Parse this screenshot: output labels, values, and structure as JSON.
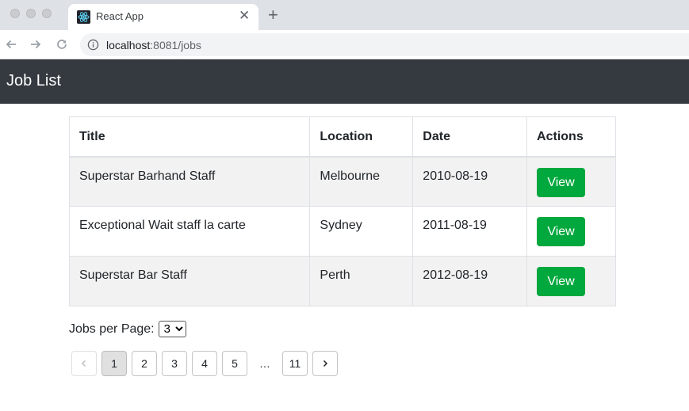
{
  "browser": {
    "tab_title": "React App",
    "tab_close": "✕",
    "new_tab": "+",
    "url_host": "localhost",
    "url_rest": ":8081/jobs"
  },
  "header": {
    "title": "Job List"
  },
  "table": {
    "columns": [
      "Title",
      "Location",
      "Date",
      "Actions"
    ],
    "rows": [
      {
        "title": "Superstar Barhand Staff",
        "location": "Melbourne",
        "date": "2010-08-19",
        "action": "View"
      },
      {
        "title": "Exceptional Wait staff la carte",
        "location": "Sydney",
        "date": "2011-08-19",
        "action": "View"
      },
      {
        "title": "Superstar Bar Staff",
        "location": "Perth",
        "date": "2012-08-19",
        "action": "View"
      }
    ]
  },
  "per_page": {
    "label": "Jobs per Page:",
    "selected": "3"
  },
  "pagination": {
    "pages": [
      "1",
      "2",
      "3",
      "4",
      "5"
    ],
    "ellipsis": "…",
    "last_page": "11",
    "current": "1"
  },
  "colors": {
    "header_bg": "#343a40",
    "view_button": "#00a83d",
    "stripe": "#f2f2f2"
  }
}
